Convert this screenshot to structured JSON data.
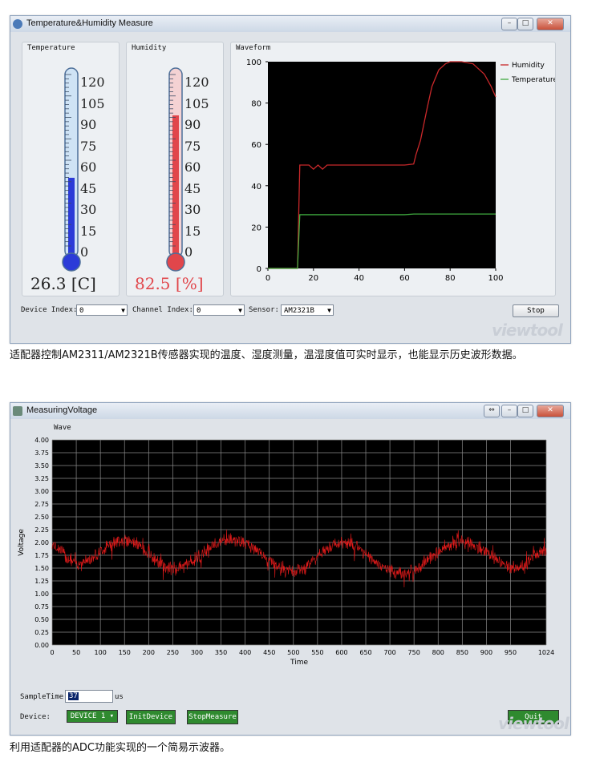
{
  "window1": {
    "title": "Temperature&Humidity Measure",
    "temperature": {
      "group_label": "Temperature",
      "scale": [
        "120",
        "105",
        "90",
        "75",
        "60",
        "45",
        "30",
        "15",
        "0"
      ],
      "reading": "26.3 [C]",
      "fill_fraction": 0.42,
      "color": "#2b3bd8"
    },
    "humidity": {
      "group_label": "Humidity",
      "scale": [
        "120",
        "105",
        "90",
        "75",
        "60",
        "45",
        "30",
        "15",
        "0"
      ],
      "reading": "82.5 [%]",
      "fill_fraction": 0.75,
      "color": "#e1464b"
    },
    "waveform": {
      "group_label": "Waveform",
      "legend": [
        "Humidity",
        "Temperature"
      ],
      "x_ticks": [
        "0",
        "20",
        "40",
        "60",
        "80",
        "100"
      ],
      "y_ticks": [
        "0",
        "20",
        "40",
        "60",
        "80",
        "100"
      ]
    },
    "controls": {
      "device_label": "Device Index:",
      "device_value": "0",
      "channel_label": "Channel Index:",
      "channel_value": "0",
      "sensor_label": "Sensor:",
      "sensor_value": "AM2321B",
      "stop_label": "Stop"
    },
    "logo": "viewtool"
  },
  "caption1": "适配器控制AM2311/AM2321B传感器实现的温度、湿度测量，温湿度值可实时显示，也能显示历史波形数据。",
  "window2": {
    "title": "MeasuringVoltage",
    "wave_label": "Wave",
    "y_axis_label": "Voltage",
    "x_axis_label": "Time",
    "y_ticks": [
      "4.00",
      "3.75",
      "3.50",
      "3.25",
      "3.00",
      "2.75",
      "2.50",
      "2.25",
      "2.00",
      "1.75",
      "1.50",
      "1.25",
      "1.00",
      "0.75",
      "0.50",
      "0.25",
      "0.00"
    ],
    "x_ticks": [
      "0",
      "50",
      "100",
      "150",
      "200",
      "250",
      "300",
      "350",
      "400",
      "450",
      "500",
      "550",
      "600",
      "650",
      "700",
      "750",
      "800",
      "850",
      "900",
      "950",
      "1024"
    ],
    "controls": {
      "sample_time_label": "SampleTime:",
      "sample_time_value": "37",
      "sample_time_unit": "us",
      "device_label": "Device:",
      "device_value": "DEVICE 1",
      "init_button": "InitDevice",
      "stop_button": "StopMeasure",
      "quit_button": "Quit"
    },
    "logo": "viewtool"
  },
  "caption2": "利用适配器的ADC功能实现的一个简易示波器。",
  "chart_data": [
    {
      "type": "line",
      "x": [
        0,
        5,
        10,
        12,
        13,
        14,
        16,
        18,
        20,
        22,
        24,
        26,
        30,
        40,
        50,
        60,
        64,
        65,
        67,
        70,
        72,
        75,
        78,
        80,
        85,
        90,
        95,
        98,
        100
      ],
      "series": [
        {
          "name": "Humidity",
          "color": "#c8282a",
          "values": [
            0,
            0,
            0,
            0,
            0,
            50,
            50,
            50,
            48,
            50,
            48,
            50,
            50,
            50,
            50,
            50,
            50.5,
            55,
            62,
            78,
            88,
            96,
            99,
            100,
            100,
            99,
            94,
            88,
            83
          ]
        },
        {
          "name": "Temperature",
          "color": "#3faa3f",
          "values": [
            0,
            0,
            0,
            0,
            0,
            26,
            26,
            26,
            26,
            26,
            26,
            26,
            26,
            26,
            26,
            26,
            26.3,
            26.3,
            26.3,
            26.3,
            26.3,
            26.3,
            26.3,
            26.3,
            26.3,
            26.3,
            26.3,
            26.3,
            26.3
          ]
        }
      ],
      "xlim": [
        0,
        100
      ],
      "ylim": [
        0,
        100
      ],
      "legend": "top-right"
    },
    {
      "type": "line",
      "xlabel": "Time",
      "ylabel": "Voltage",
      "xlim": [
        0,
        1024
      ],
      "ylim": [
        0,
        4
      ],
      "grid": true,
      "series": [
        {
          "color": "#e11a1a",
          "center_x": [
            0,
            50,
            150,
            250,
            370,
            500,
            600,
            720,
            850,
            960,
            1024
          ],
          "center_y": [
            1.95,
            1.6,
            2.05,
            1.5,
            2.05,
            1.45,
            2.0,
            1.4,
            2.0,
            1.5,
            1.85
          ],
          "noise_amplitude": 0.15
        }
      ]
    }
  ]
}
